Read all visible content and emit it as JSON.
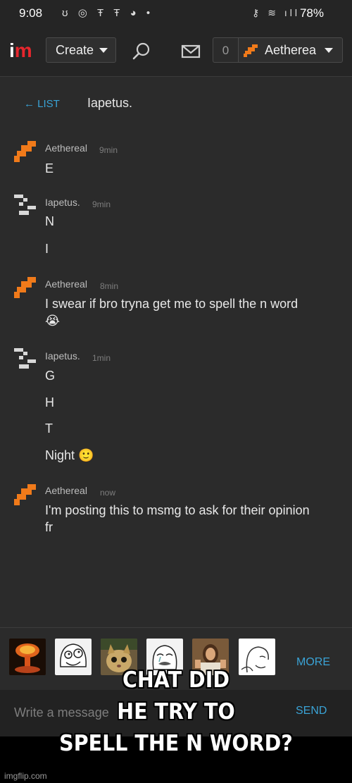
{
  "status_bar": {
    "time": "9:08",
    "left_icons": "ʊ ◎ Ŧ Ŧ ◕ •",
    "right_icons": "⚷ ≋ ıll",
    "battery": "78%"
  },
  "nav": {
    "logo_i": "i",
    "logo_m": "m",
    "create_label": "Create",
    "notification_count": "0",
    "username": "Aetherea"
  },
  "chat": {
    "back_label": "← LIST",
    "title": "Iapetus.",
    "messages": [
      {
        "user": "Aethereal",
        "time": "9min",
        "lines": [
          "E"
        ]
      },
      {
        "user": "Iapetus.",
        "time": "9min",
        "lines": [
          "N",
          "I"
        ]
      },
      {
        "user": "Aethereal",
        "time": "8min",
        "lines": [
          "I swear if bro tryna get me to spell the n word",
          "😭"
        ]
      },
      {
        "user": "Iapetus.",
        "time": "1min",
        "lines": [
          "G",
          "H",
          "T",
          "Night 🙂"
        ]
      },
      {
        "user": "Aethereal",
        "time": "now",
        "lines": [
          "I'm posting this to msmg to ask for their opinion",
          "fr"
        ]
      }
    ]
  },
  "memes": {
    "items": [
      "mushroom-cloud-meme",
      "derp-face-meme",
      "cat-meme",
      "crying-face-meme",
      "jesus-thumbs-up-meme",
      "wojak-meme"
    ],
    "more_label": "MORE"
  },
  "composer": {
    "placeholder": "Write a message",
    "send_label": "SEND"
  },
  "watermark": "imgflip.com",
  "caption": {
    "line1": "CHAT DID",
    "line2": "HE TRY TO",
    "line3": "SPELL THE N WORD?"
  },
  "colors": {
    "accent_blue": "#3aa3d6",
    "brand_red": "#e8262d",
    "avatar_orange": "#f07a1a"
  }
}
